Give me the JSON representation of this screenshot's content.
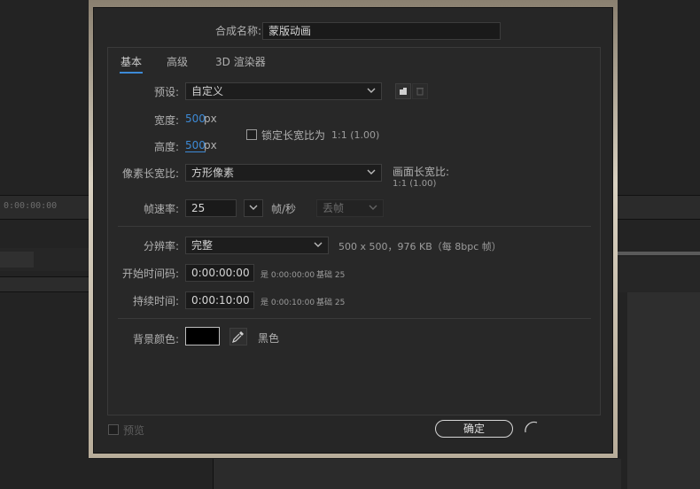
{
  "background": {
    "timecode": "0:00:00:00"
  },
  "dialog": {
    "comp_name_label": "合成名称:",
    "comp_name_value": "蒙版动画",
    "tabs": [
      {
        "label": "基本",
        "active": true
      },
      {
        "label": "高级",
        "active": false
      },
      {
        "label": "3D 渲染器",
        "active": false
      }
    ],
    "preset": {
      "label": "预设:",
      "value": "自定义"
    },
    "width": {
      "label": "宽度:",
      "value": "500",
      "unit": "px"
    },
    "height": {
      "label": "高度:",
      "value": "500",
      "unit": "px"
    },
    "lock_aspect": {
      "label": "锁定长宽比为",
      "ratio": "1:1 (1.00)",
      "checked": false
    },
    "pixel_aspect": {
      "label": "像素长宽比:",
      "value": "方形像素"
    },
    "frame_aspect": {
      "label": "画面长宽比:",
      "value": "1:1 (1.00)"
    },
    "frame_rate": {
      "label": "帧速率:",
      "value": "25",
      "unit": "帧/秒",
      "drop": "丢帧"
    },
    "resolution": {
      "label": "分辨率:",
      "value": "完整",
      "info": "500 x 500，976 KB（每 8bpc 帧）"
    },
    "start_timecode": {
      "label": "开始时间码:",
      "value": "0:00:00:00",
      "note": "是 0:00:00:00",
      "base": "基础 25"
    },
    "duration": {
      "label": "持续时间:",
      "value": "0:00:10:00",
      "note": "是 0:00:10:00",
      "base": "基础 25"
    },
    "bg_color": {
      "label": "背景颜色:",
      "name": "黑色",
      "color": "#000000"
    },
    "preview_label": "预览",
    "ok_label": "确定"
  },
  "colors": {
    "accent": "#3d8ad6"
  }
}
